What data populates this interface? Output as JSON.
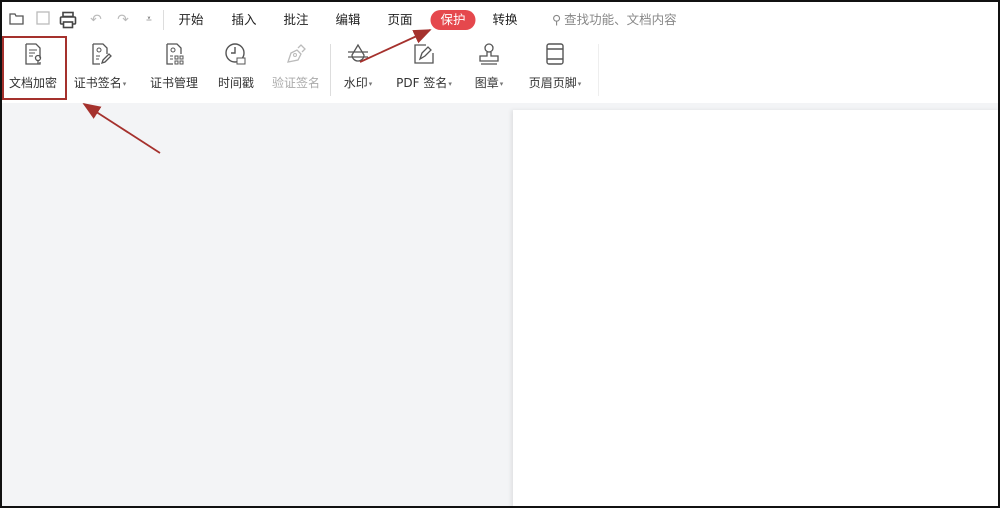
{
  "quick_access": [
    "open-icon",
    "save-icon",
    "print-icon",
    "undo-icon",
    "redo-icon",
    "customize-icon"
  ],
  "tabs": [
    "开始",
    "插入",
    "批注",
    "编辑",
    "页面",
    "保护",
    "转换"
  ],
  "active_tab": "保护",
  "search": {
    "placeholder": "查找功能、文档内容"
  },
  "ribbon": {
    "encrypt": "文档加密",
    "cert_sign": "证书签名",
    "cert_manage": "证书管理",
    "timestamp": "时间戳",
    "verify_sign": "验证签名",
    "watermark": "水印",
    "pdf_sign": "PDF 签名",
    "stamp": "图章",
    "header_footer": "页眉页脚"
  },
  "caret": "▾",
  "colors": {
    "accent": "#e5484d",
    "annotation": "#a5312d"
  }
}
